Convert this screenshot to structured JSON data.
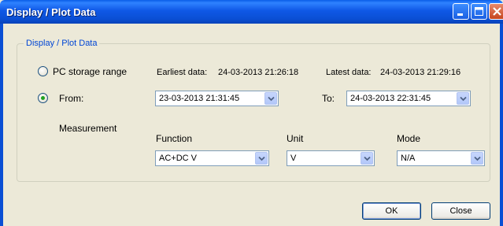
{
  "window": {
    "title": "Display / Plot Data"
  },
  "group": {
    "legend": "Display / Plot Data"
  },
  "range": {
    "pc_storage_label": "PC storage range",
    "pc_storage_selected": false,
    "from_label": "From:",
    "from_selected": true,
    "earliest_label": "Earliest data:",
    "earliest_value": "24-03-2013 21:26:18",
    "latest_label": "Latest data:",
    "latest_value": "24-03-2013 21:29:16",
    "from_value": "23-03-2013 21:31:45",
    "to_label": "To:",
    "to_value": "24-03-2013 22:31:45"
  },
  "measurement": {
    "label": "Measurement",
    "function_label": "Function",
    "function_value": "AC+DC V",
    "unit_label": "Unit",
    "unit_value": "V",
    "mode_label": "Mode",
    "mode_value": "N/A"
  },
  "buttons": {
    "ok": "OK",
    "close": "Close"
  },
  "colors": {
    "titlebar": "#0a4fd4",
    "legend": "#0046d5",
    "radio_dot": "#21a121",
    "dialog_bg": "#ece9d8"
  },
  "icons": {
    "dropdown": "chevron-down-icon",
    "minimize": "minimize-icon",
    "maximize": "maximize-icon",
    "close": "close-icon"
  }
}
